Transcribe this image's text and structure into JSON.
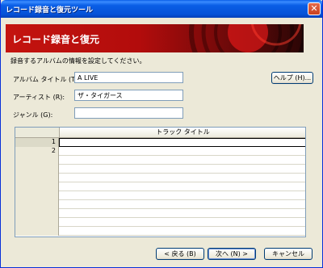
{
  "window": {
    "title": "レコード録音と復元ツール",
    "close_glyph": "✕"
  },
  "banner": {
    "heading": "レコード録音と復元"
  },
  "instruction": "録音するアルバムの情報を設定してください。",
  "form": {
    "album_label": "アルバム タイトル (T):",
    "album_value": "A LIVE",
    "artist_label": "アーティスト (R):",
    "artist_value": "ザ・タイガース",
    "genre_label": "ジャンル (G):",
    "genre_value": ""
  },
  "help_button": "ヘルプ (H)...",
  "table": {
    "column_header": "トラック タイトル",
    "rows": [
      {
        "num": "1",
        "title": ""
      },
      {
        "num": "2",
        "title": ""
      },
      {
        "num": "",
        "title": ""
      },
      {
        "num": "",
        "title": ""
      },
      {
        "num": "",
        "title": ""
      },
      {
        "num": "",
        "title": ""
      },
      {
        "num": "",
        "title": ""
      },
      {
        "num": "",
        "title": ""
      },
      {
        "num": "",
        "title": ""
      },
      {
        "num": "",
        "title": ""
      },
      {
        "num": "",
        "title": ""
      }
    ]
  },
  "footer": {
    "back": "< 戻る (B)",
    "next": "次へ (N) >",
    "cancel": "キャンセル"
  }
}
